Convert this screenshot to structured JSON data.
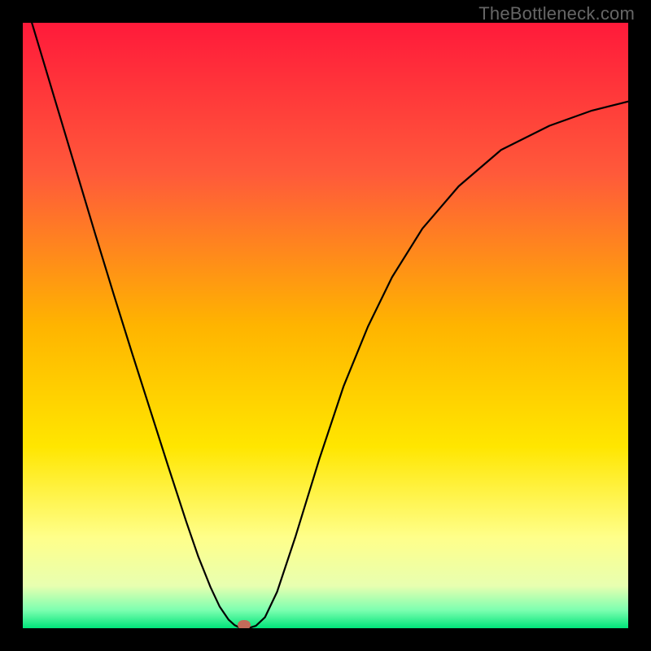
{
  "watermark": "TheBottleneck.com",
  "chart_data": {
    "type": "line",
    "title": "",
    "xlabel": "",
    "ylabel": "",
    "xlim": [
      0,
      1
    ],
    "ylim": [
      0,
      1
    ],
    "grid": false,
    "legend": false,
    "background_gradient": {
      "direction": "vertical",
      "stops": [
        {
          "pos": 0.0,
          "color": "#ff1a3a"
        },
        {
          "pos": 0.25,
          "color": "#ff5a3a"
        },
        {
          "pos": 0.5,
          "color": "#ffb400"
        },
        {
          "pos": 0.7,
          "color": "#ffe600"
        },
        {
          "pos": 0.85,
          "color": "#ffff8a"
        },
        {
          "pos": 0.93,
          "color": "#e8ffb0"
        },
        {
          "pos": 0.97,
          "color": "#7dffb0"
        },
        {
          "pos": 1.0,
          "color": "#00e47a"
        }
      ]
    },
    "series": [
      {
        "name": "bottleneck-curve",
        "color": "#000000",
        "stroke_width": 2.2,
        "x": [
          0.0,
          0.03,
          0.06,
          0.09,
          0.12,
          0.15,
          0.18,
          0.21,
          0.24,
          0.27,
          0.29,
          0.31,
          0.325,
          0.34,
          0.35,
          0.36,
          0.372,
          0.385,
          0.4,
          0.42,
          0.45,
          0.49,
          0.53,
          0.57,
          0.61,
          0.66,
          0.72,
          0.79,
          0.87,
          0.94,
          1.0
        ],
        "y": [
          1.05,
          0.95,
          0.85,
          0.75,
          0.65,
          0.552,
          0.456,
          0.362,
          0.268,
          0.176,
          0.118,
          0.068,
          0.036,
          0.014,
          0.005,
          0.0,
          0.0,
          0.004,
          0.018,
          0.06,
          0.15,
          0.28,
          0.4,
          0.498,
          0.58,
          0.66,
          0.73,
          0.79,
          0.83,
          0.855,
          0.87
        ]
      }
    ],
    "marker": {
      "name": "optimal-point",
      "x": 0.365,
      "y": 0.005,
      "color": "#c36b5a"
    }
  }
}
